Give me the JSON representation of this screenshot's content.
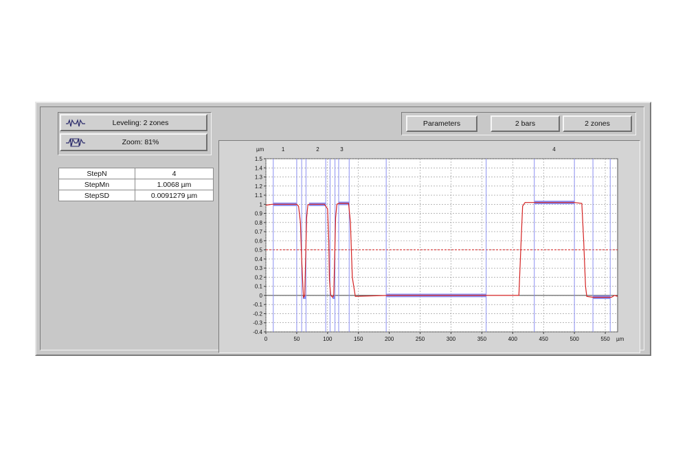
{
  "buttons": {
    "leveling": "Leveling: 2 zones",
    "zoom": "Zoom: 81%",
    "parameters": "Parameters",
    "bars": "2 bars",
    "zones": "2 zones"
  },
  "icons": {
    "leveling": "leveling-wave-icon",
    "zoom": "zoom-wave-icon"
  },
  "stats": [
    {
      "label": "StepN",
      "value": "4"
    },
    {
      "label": "StepMn",
      "value": "1.0068 µm"
    },
    {
      "label": "StepSD",
      "value": "0.0091279 µm"
    }
  ],
  "colors": {
    "profile": "#d42020",
    "zones": "#8a8ef0",
    "threshold": "#d42020",
    "grid": "#8c8c8c"
  },
  "chart_data": {
    "type": "line",
    "ylabel": "µm",
    "xlabel": "µm",
    "xlim": [
      0,
      570
    ],
    "ylim": [
      -0.4,
      1.5
    ],
    "xticks": [
      0,
      50,
      100,
      150,
      200,
      250,
      300,
      350,
      400,
      450,
      500,
      550
    ],
    "yticks": [
      -0.4,
      -0.3,
      -0.2,
      -0.1,
      0,
      0.1,
      0.2,
      0.3,
      0.4,
      0.5,
      0.6,
      0.7,
      0.8,
      0.9,
      1,
      1.1,
      1.2,
      1.3,
      1.4,
      1.5
    ],
    "grid": true,
    "threshold": 0.5,
    "step_labels": [
      {
        "text": "1",
        "x": 28
      },
      {
        "text": "2",
        "x": 84
      },
      {
        "text": "3",
        "x": 123
      },
      {
        "text": "4",
        "x": 467
      }
    ],
    "zone_lines": [
      12,
      50,
      58,
      65,
      97,
      104,
      112,
      118,
      135,
      195,
      357,
      435,
      500,
      530,
      558
    ],
    "zone_bars": [
      {
        "x0": 12,
        "x1": 50,
        "y": 1.0
      },
      {
        "x0": 70,
        "x1": 97,
        "y": 1.0
      },
      {
        "x0": 118,
        "x1": 135,
        "y": 1.01
      },
      {
        "x0": 435,
        "x1": 500,
        "y": 1.02
      },
      {
        "x0": 60,
        "x1": 65,
        "y": -0.02
      },
      {
        "x0": 108,
        "x1": 112,
        "y": -0.02
      },
      {
        "x0": 195,
        "x1": 357,
        "y": 0.0
      },
      {
        "x0": 530,
        "x1": 558,
        "y": -0.02
      }
    ],
    "series": [
      {
        "x": [
          0,
          10,
          50,
          53,
          56,
          58,
          60,
          61,
          63,
          66,
          68,
          70,
          95,
          100,
          102,
          103,
          105,
          108,
          110,
          113,
          115,
          118,
          134,
          137,
          140,
          145,
          200,
          360,
          410,
          413,
          416,
          420,
          500,
          512,
          515,
          518,
          520,
          530,
          560,
          565,
          570
        ],
        "y": [
          0.99,
          1.0,
          1.0,
          0.98,
          0.8,
          0.4,
          0.1,
          -0.02,
          0.0,
          0.85,
          0.99,
          1.0,
          1.0,
          0.95,
          0.6,
          0.18,
          0.0,
          -0.02,
          0.0,
          0.85,
          1.0,
          1.01,
          1.01,
          0.8,
          0.2,
          -0.01,
          0.0,
          0.0,
          0.0,
          0.5,
          0.98,
          1.02,
          1.02,
          1.01,
          0.6,
          0.1,
          -0.01,
          -0.02,
          -0.02,
          0.0,
          -0.01
        ]
      }
    ]
  }
}
